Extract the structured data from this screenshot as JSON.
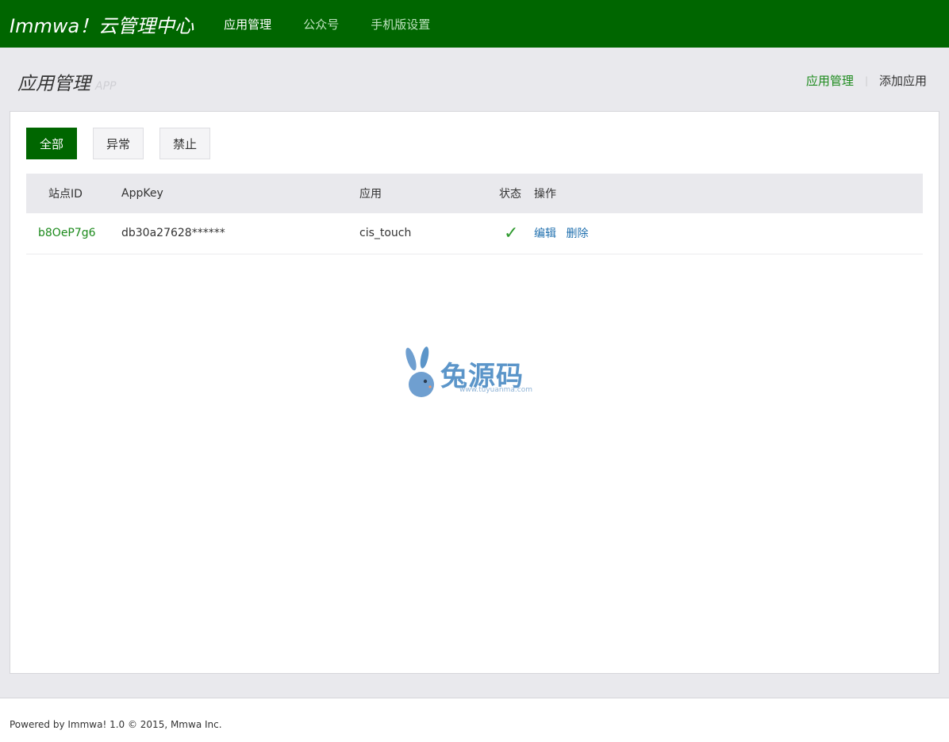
{
  "header": {
    "brand": "Immwa！云管理中心",
    "nav": [
      {
        "label": "应用管理",
        "active": true
      },
      {
        "label": "公众号",
        "active": false
      },
      {
        "label": "手机版设置",
        "active": false
      }
    ]
  },
  "page": {
    "title": "应用管理",
    "subtitle": "APP",
    "links": {
      "current": "应用管理",
      "add": "添加应用"
    }
  },
  "filters": [
    {
      "label": "全部",
      "active": true
    },
    {
      "label": "异常",
      "active": false
    },
    {
      "label": "禁止",
      "active": false
    }
  ],
  "table": {
    "headers": {
      "site_id": "站点ID",
      "appkey": "AppKey",
      "app": "应用",
      "status": "状态",
      "ops": "操作"
    },
    "rows": [
      {
        "site_id": "b8OeP7g6",
        "appkey": "db30a27628******",
        "app": "cis_touch",
        "status": "✓",
        "edit": "编辑",
        "delete": "删除"
      }
    ]
  },
  "watermark": {
    "text": "兔源码",
    "url": "www.tuyuanma.com"
  },
  "footer": {
    "text": "Powered by Immwa! 1.0 © 2015, Mmwa Inc."
  },
  "colors": {
    "brand_green": "#006600",
    "link_green": "#1c8a1c",
    "link_blue": "#1f6fae",
    "background": "#e9e9ed"
  }
}
